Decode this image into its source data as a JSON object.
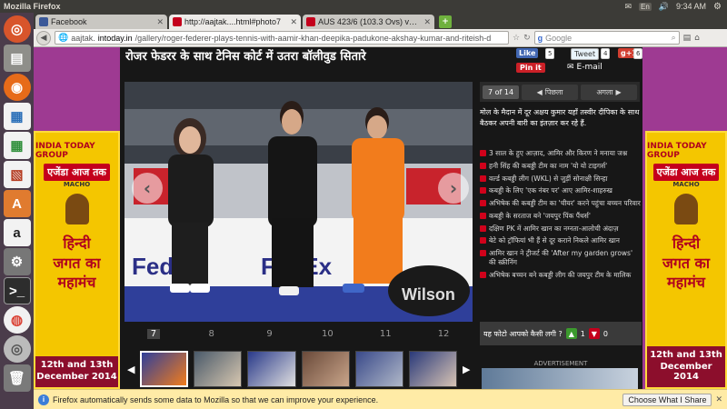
{
  "panel": {
    "window_title": "Mozilla Firefox",
    "lang": "En",
    "time": "9:34 AM"
  },
  "tabs": [
    {
      "label": "Facebook",
      "favicon_color": "#3b5998"
    },
    {
      "label": "http://aajtak....html#photo7",
      "favicon_color": "#c4001c"
    },
    {
      "label": "AUS 423/6 (103.3 Ovs) vs IN...",
      "favicon_color": "#c4001c"
    }
  ],
  "nav": {
    "url_prefix": "aajtak.",
    "url_domain": "intoday.in",
    "url_path": "/gallery/roger-federer-plays-tennis-with-aamir-khan-deepika-padukone-akshay-kumar-and-riteish-d",
    "search_placeholder": "Google"
  },
  "gallery": {
    "title": "रोजर फेडरर के साथ टेनिस कोर्ट में उतरा बॉलीवुड सितारे",
    "counter": "7 of 14",
    "prev": "पिछला",
    "next": "अगला",
    "caption": "मोल के मैदान में दूर अक्षय कुमार यहाँ तस्वीर दीपिका के साथ बैठकर अपनी बारी का इंतज़ार कर रहे हैं."
  },
  "share": {
    "like": "Like",
    "like_count": "5",
    "tweet": "Tweet",
    "tweet_count": "4",
    "gplus": "g+1",
    "gplus_count": "6",
    "pin": "Pin it",
    "email": "E-mail"
  },
  "related": [
    "3 साल के हुए आज़ाद, आमिर और किरण ने मनाया जश्न",
    "हनी सिंह की कबड्डी टीम का नाम 'यो यो टाइगर्स'",
    "वर्ल्ड कबड्डी लीग (WKL) से जुड़ीं सोनाक्षी सिन्हा",
    "कबड्डी के लिए 'एक नंबर पर' आए आमिर-शाहरुख",
    "अभिषेक की कबड्डी टीम का 'चीयर' करने पहुंचा बच्चन परिवार",
    "कबड्डी के सरताज बने 'जयपुर पिंक पैंथर्स'",
    "दक्षिण PK में आमिर खान का नग्नता-आलोची अंदाज़",
    "बेटे को ट्रॉफियां भी हैं से दूर कराने निकले आमिर खान",
    "आमिर खान ने ट्रीजर्ट की 'After my garden grows' की स्क्रीनिंग",
    "अभिषेक बच्चन बने कबड्डी लीग की जयपुर टीम के मालिक"
  ],
  "rating": {
    "question": "यह फोटो आपको कैसी लगी ?",
    "likes": "1",
    "dislikes": "0"
  },
  "advertisement": "ADVERTISEMENT",
  "thumb_numbers": [
    "7",
    "8",
    "9",
    "10",
    "11",
    "12"
  ],
  "ad": {
    "logo": "INDIA TODAY GROUP",
    "brand": "एजेंडा आज तक",
    "partner": "MACHO",
    "headline": [
      "हिन्दी",
      "जगत का",
      "महामंच"
    ],
    "dates": "12th and 13th",
    "year": "December 2014"
  },
  "notification": {
    "text": "Firefox automatically sends some data to Mozilla so that we can improve your experience.",
    "button": "Choose What I Share"
  },
  "colors": {
    "brand_red": "#c4001c",
    "ad_purple": "#9e3a92",
    "ad_yellow": "#f4c600"
  }
}
